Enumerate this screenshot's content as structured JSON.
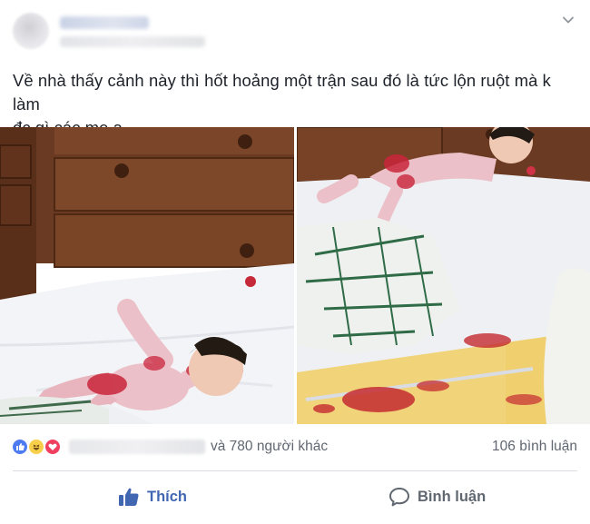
{
  "post": {
    "caption_line1": "Về nhà thấy cảnh này thì hốt hoảng một trận sau đó là tức lộn ruột mà k làm",
    "caption_line2": "đc gì các mẹ ạ",
    "photos": [
      {
        "icon": "photo-left"
      },
      {
        "icon": "photo-right"
      }
    ]
  },
  "reactions": {
    "icons": [
      "like-reaction-icon",
      "haha-reaction-icon",
      "love-reaction-icon"
    ],
    "others_text": "và 780 người khác",
    "comments_text": "106 bình luận"
  },
  "actions": {
    "like_label": "Thích",
    "comment_label": "Bình luận"
  },
  "colors": {
    "like_blue": "#4267b2",
    "secondary_text": "#606770",
    "divider": "#dadde1"
  }
}
